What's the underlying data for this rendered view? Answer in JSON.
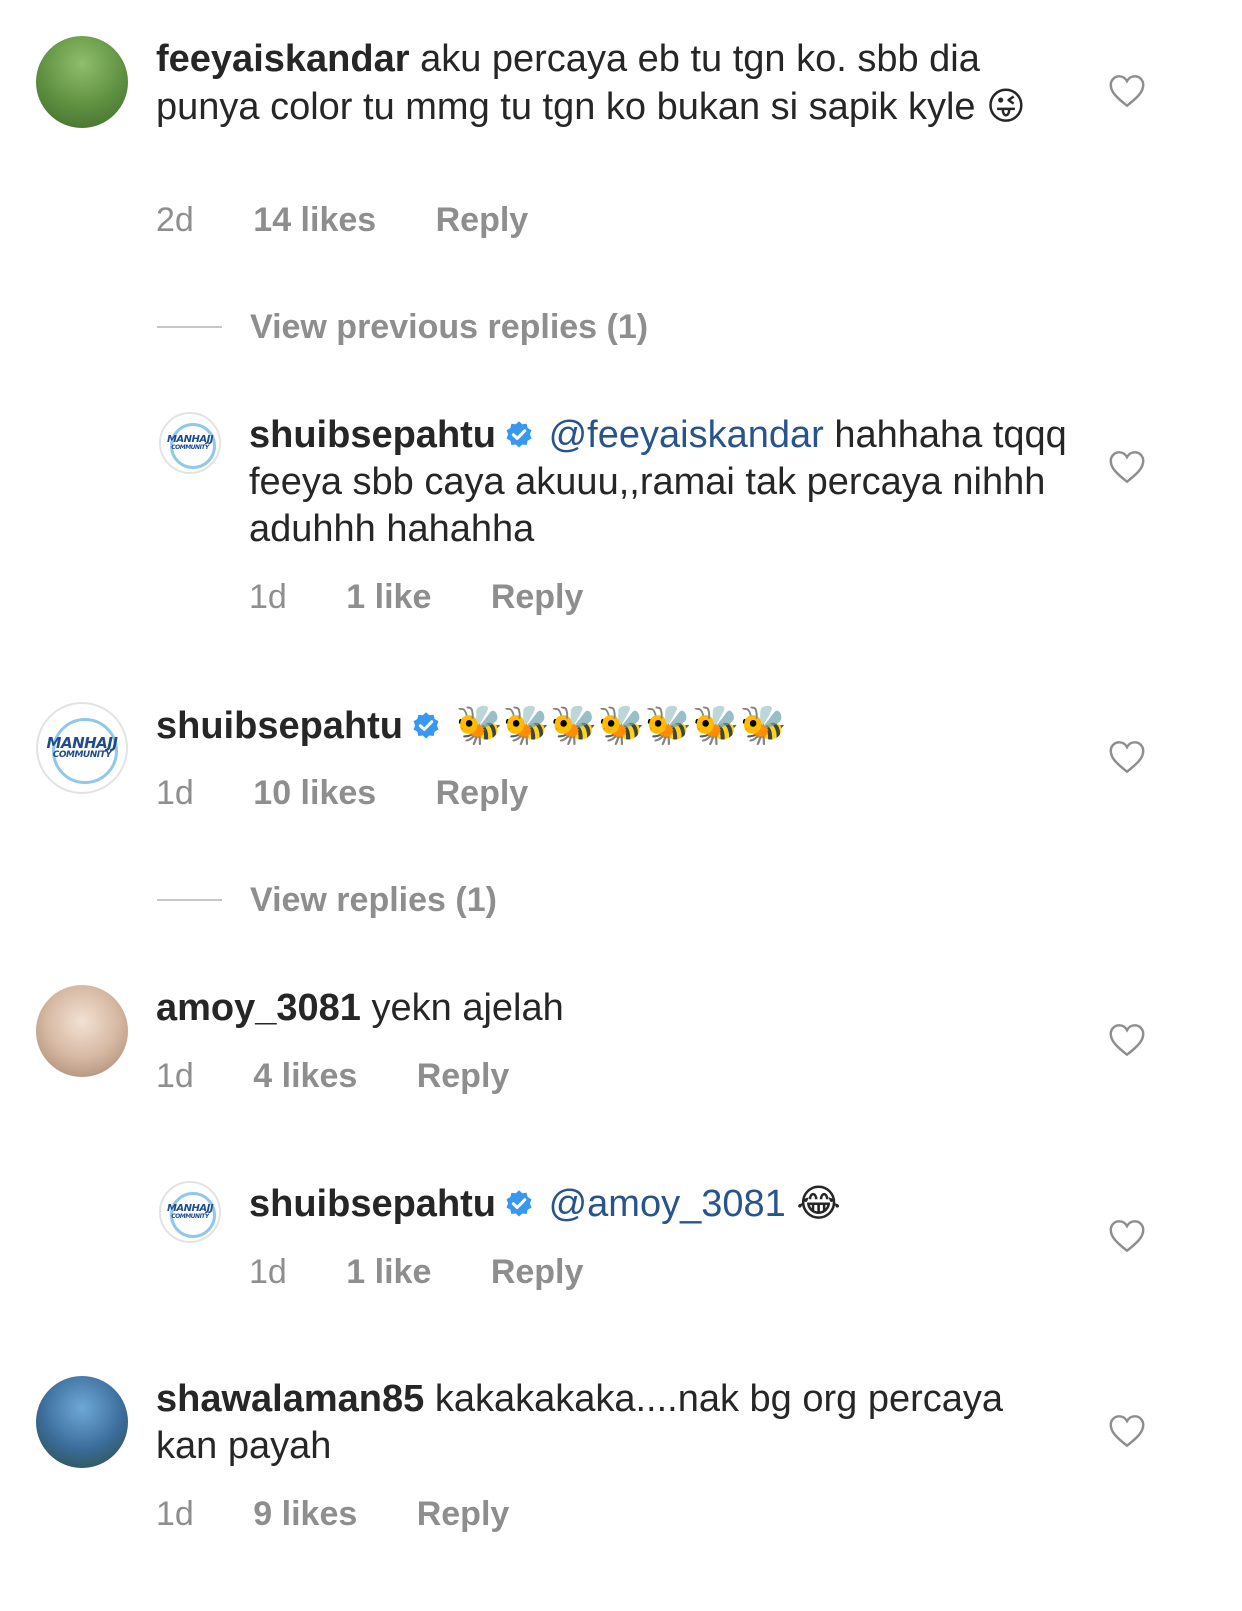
{
  "comments": [
    {
      "username": "feeyaiskandar",
      "text": "aku percaya eb tu tgn ko. sbb dia punya color tu mmg tu tgn ko bukan si sapik kyle",
      "emoji": "😜",
      "time": "2d",
      "likes": "14 likes",
      "reply_label": "Reply"
    },
    {
      "username": "shuibsepahtu",
      "mention": "@feeyaiskandar",
      "text": "hahhaha tqqq feeya sbb caya akuuu,,ramai tak percaya nihhh aduhhh hahahha",
      "time": "1d",
      "likes": "1 like",
      "reply_label": "Reply"
    },
    {
      "username": "shuibsepahtu",
      "emoji": "🐝🐝🐝🐝🐝🐝🐝",
      "time": "1d",
      "likes": "10 likes",
      "reply_label": "Reply"
    },
    {
      "username": "amoy_3081",
      "text": "yekn ajelah",
      "time": "1d",
      "likes": "4 likes",
      "reply_label": "Reply"
    },
    {
      "username": "shuibsepahtu",
      "mention": "@amoy_3081",
      "emoji": "😂",
      "time": "1d",
      "likes": "1 like",
      "reply_label": "Reply"
    },
    {
      "username": "shawalaman85",
      "text": "kakakakaka....nak bg org percaya kan payah",
      "time": "1d",
      "likes": "9 likes",
      "reply_label": "Reply"
    }
  ],
  "threads": {
    "previous": "View previous replies (1)",
    "view": "View replies (1)"
  },
  "logo": {
    "line1": "MANHAJJ",
    "line2": "COMMUNITY"
  },
  "colors": {
    "text": "#262626",
    "meta": "#8e8e8e",
    "mention": "#27548c",
    "verified": "#3897f0"
  },
  "icons": {
    "like": "heart-outline-icon",
    "verified": "verified-badge-icon"
  }
}
